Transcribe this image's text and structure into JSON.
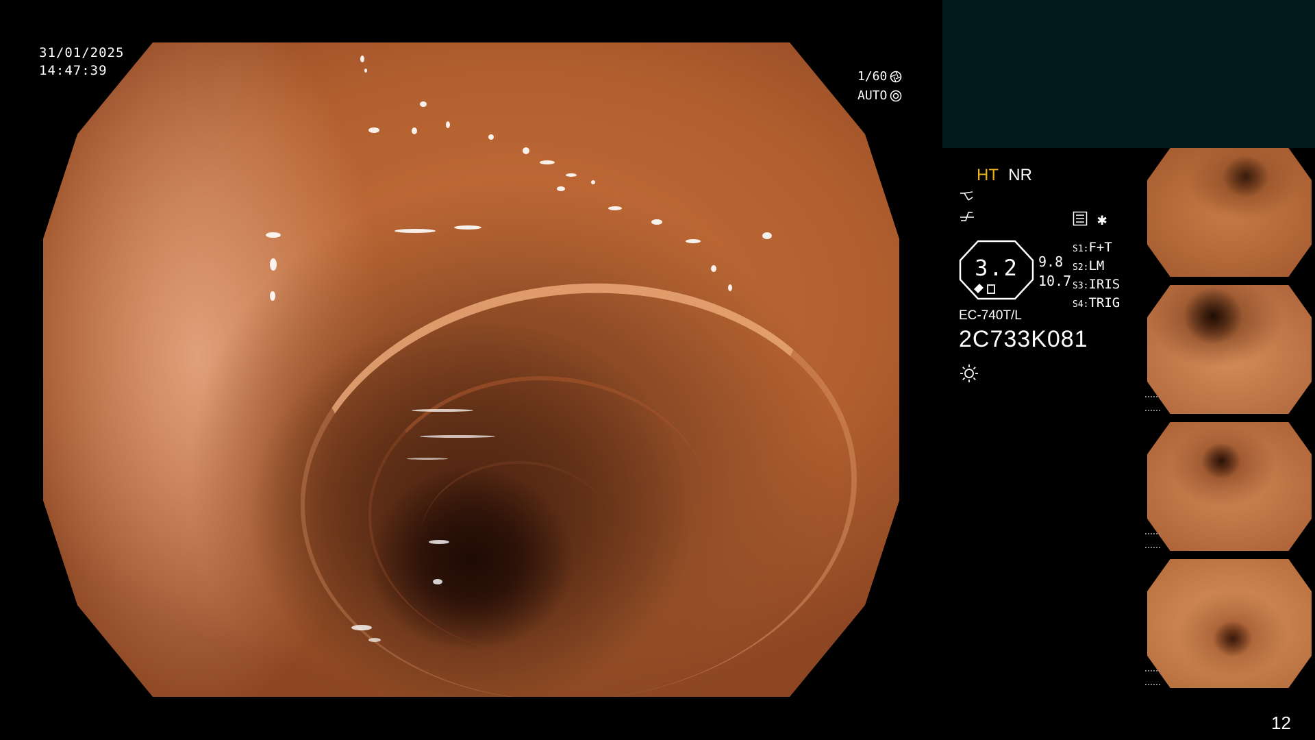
{
  "overlay": {
    "date": "31/01/2025",
    "time": "14:47:39",
    "shutter": "1/60",
    "exposure_mode": "AUTO"
  },
  "status": {
    "mode_ht": "HT",
    "mode_nr": "NR",
    "dial_value": "3.2",
    "value_a": "9.8",
    "value_b": "10.7",
    "switches": [
      {
        "tag": "S1:",
        "value": "F+T"
      },
      {
        "tag": "S2:",
        "value": "LM"
      },
      {
        "tag": "S3:",
        "value": "IRIS"
      },
      {
        "tag": "S4:",
        "value": "TRIG"
      }
    ],
    "scope_model": "EC-740T/L",
    "scope_serial": "2C733K081"
  },
  "icons": {
    "shutter_icon": "aperture-icon",
    "auto_icon": "target-icon",
    "curve_icon": "tone-curve-icon",
    "scribble_icon": "enhance-icon",
    "menu_icon": "settings-list-icon",
    "star_icon": "asterisk-icon",
    "light_icon": "sun-icon"
  },
  "colors": {
    "background": "#000000",
    "teal_panel": "#021a1d",
    "ht_accent": "#f2b21a",
    "text": "#ffffff"
  },
  "thumbnails_count": 4,
  "page_number": "12"
}
